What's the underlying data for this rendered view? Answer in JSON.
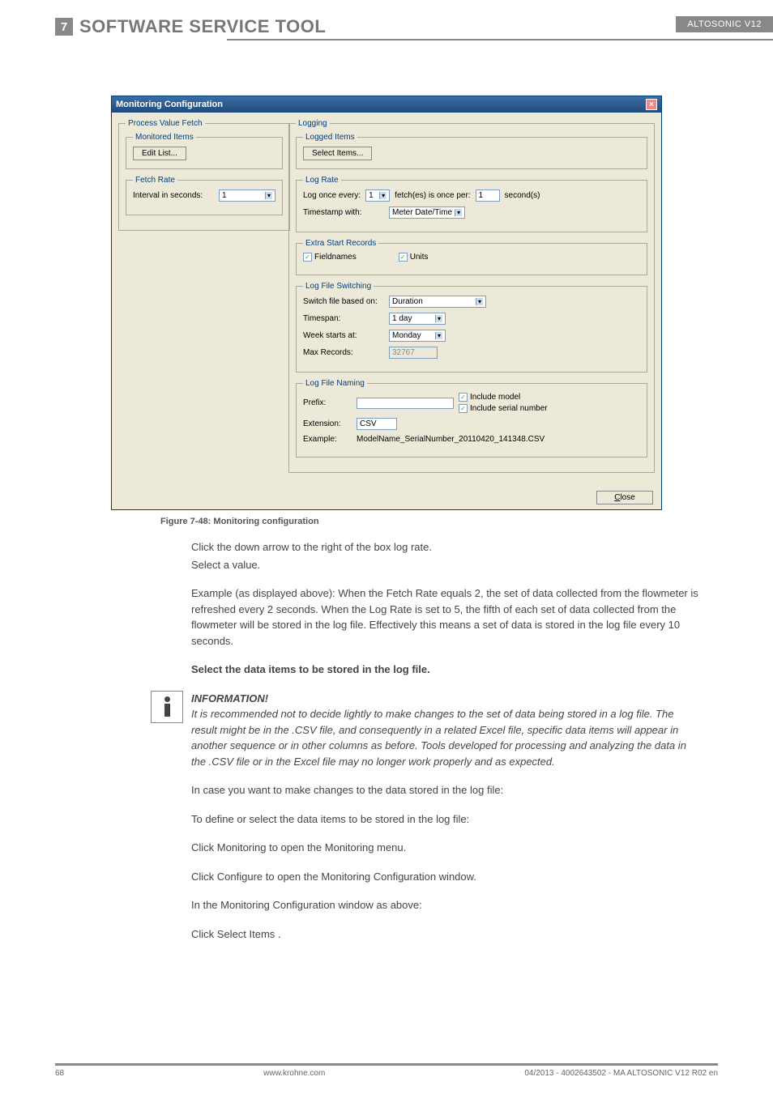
{
  "header": {
    "chapter_num": "7",
    "chapter_title": "SOFTWARE SERVICE TOOL",
    "product": "ALTOSONIC V12"
  },
  "dialog": {
    "title": "Monitoring Configuration",
    "process_value_fetch": {
      "legend": "Process Value Fetch",
      "monitored_items": {
        "legend": "Monitored Items",
        "edit_btn": "Edit List..."
      },
      "fetch_rate": {
        "legend": "Fetch Rate",
        "interval_label": "Interval in seconds:",
        "interval_value": "1"
      }
    },
    "logging": {
      "legend": "Logging",
      "logged_items": {
        "legend": "Logged Items",
        "select_btn": "Select Items..."
      },
      "log_rate": {
        "legend": "Log Rate",
        "log_once_label": "Log once every:",
        "log_once_value": "1",
        "fetches_label": "fetch(es) is once per:",
        "fetches_value": "1",
        "seconds_label": "second(s)",
        "timestamp_label": "Timestamp with:",
        "timestamp_value": "Meter Date/Time"
      },
      "extra_start": {
        "legend": "Extra Start Records",
        "fieldnames": "Fieldnames",
        "units": "Units"
      },
      "switching": {
        "legend": "Log File Switching",
        "switch_based_label": "Switch file based on:",
        "switch_based_value": "Duration",
        "timespan_label": "Timespan:",
        "timespan_value": "1 day",
        "week_starts_label": "Week starts at:",
        "week_starts_value": "Monday",
        "max_records_label": "Max Records:",
        "max_records_value": "32767"
      },
      "naming": {
        "legend": "Log File Naming",
        "prefix_label": "Prefix:",
        "include_model": "Include model",
        "include_serial": "Include serial number",
        "extension_label": "Extension:",
        "extension_value": "CSV",
        "example_label": "Example:",
        "example_value": "ModelName_SerialNumber_20110420_141348.CSV"
      }
    },
    "close_btn": "Close"
  },
  "caption": "Figure 7-48: Monitoring configuration",
  "body": {
    "p1": "Click the down arrow to the right of the box log rate.",
    "p2": "Select a value.",
    "p3": "Example (as displayed above): When the  Fetch Rate  equals 2, the set of data collected from the flowmeter is refreshed every 2 seconds. When the  Log Rate  is set to 5, the fifth of each set of data collected from the flowmeter will be stored in the log file. Effectively this means a set of data is stored in the log file every 10 seconds.",
    "h_select": "Select the data items to be stored in the log file.",
    "info_title": "INFORMATION!",
    "info_body": "It is recommended not to decide lightly to make changes to the set of data being stored in a log file. The result might be in the .CSV file, and consequently in a related Excel file, specific data items will appear in another sequence or in other columns as before. Tools developed for processing and analyzing the data in the .CSV file or in the Excel file may no longer work properly and as expected.",
    "p4": "In case you want to make changes to the data stored in the log file:",
    "p5": "To define or select the data items to be stored in the log file:",
    "p6": "Click  Monitoring  to open the  Monitoring  menu.",
    "p7": "Click  Configure      to open the Monitoring Configuration window.",
    "p8": "In the Monitoring Configuration window as above:",
    "p9": "Click  Select Items ."
  },
  "footer": {
    "page": "68",
    "url": "www.krohne.com",
    "rev": "04/2013 - 4002643502 - MA ALTOSONIC V12 R02 en"
  }
}
